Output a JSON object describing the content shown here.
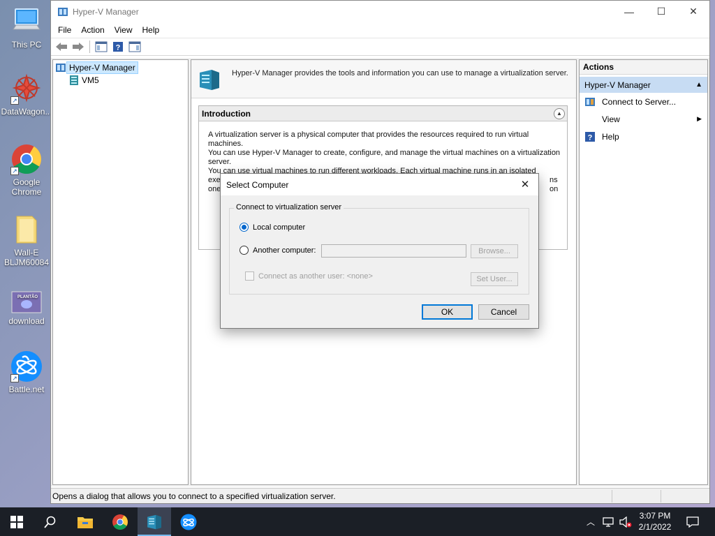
{
  "desktop": {
    "icons": [
      {
        "label": "This PC"
      },
      {
        "label": "DataWagon..."
      },
      {
        "label": "Google Chrome"
      },
      {
        "label": "Wall-E BLJM60084"
      },
      {
        "label": "download"
      },
      {
        "label": "Battle.net"
      }
    ],
    "download_thumb_text": "PLANTÃO"
  },
  "window": {
    "title": "Hyper-V Manager",
    "controls": {
      "minimize": "—",
      "maximize": "☐",
      "close": "✕"
    },
    "menu": [
      "File",
      "Action",
      "View",
      "Help"
    ]
  },
  "tree": {
    "root": "Hyper-V Manager",
    "children": [
      "VM5"
    ]
  },
  "center": {
    "header_text": "Hyper-V Manager provides the tools and information you can use to manage a virtualization server.",
    "intro_title": "Introduction",
    "intro_p1_lines": [
      "A virtualization server is a physical computer that provides the resources required to run virtual machines.",
      "You can use Hyper-V Manager to create, configure, and manage the virtual machines on a virtualization",
      "server."
    ],
    "intro_p2_lines": [
      "You can use virtual machines to run different workloads. Each virtual machine runs in an isolated",
      "exec",
      "one"
    ],
    "intro_p2_right_fragment": "ns on"
  },
  "actions": {
    "title": "Actions",
    "group": "Hyper-V Manager",
    "items": [
      {
        "label": "Connect to Server..."
      },
      {
        "label": "View"
      },
      {
        "label": "Help"
      }
    ]
  },
  "status": {
    "text": "Opens a dialog that allows you to connect to a specified virtualization server."
  },
  "dialog": {
    "title": "Select Computer",
    "group_label": "Connect to virtualization server",
    "local_label": "Local computer",
    "local_checked": true,
    "another_label": "Another computer:",
    "another_value": "",
    "browse_label": "Browse...",
    "connect_as_label": "Connect as another user: <none>",
    "set_user_label": "Set User...",
    "ok_label": "OK",
    "cancel_label": "Cancel"
  },
  "taskbar": {
    "time": "3:07 PM",
    "date": "2/1/2022"
  },
  "colors": {
    "accent": "#0078d7",
    "actions_group_bg": "#c7dcf3",
    "taskbar_bg": "#1b1f26"
  }
}
